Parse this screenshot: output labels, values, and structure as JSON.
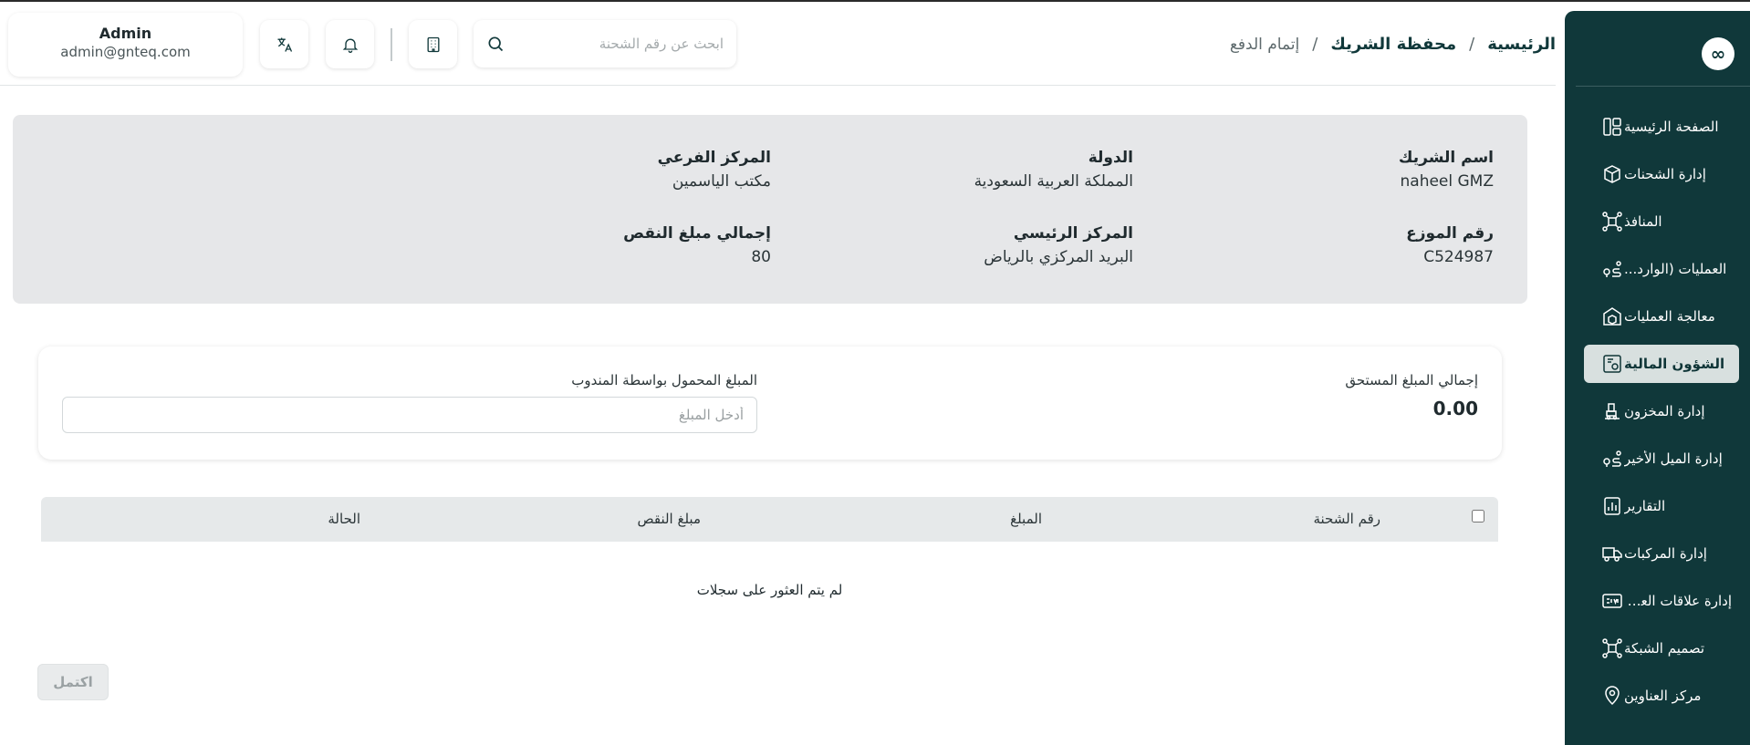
{
  "header": {
    "breadcrumb": {
      "home": "الرئيسية",
      "separator": "/",
      "wallet": "محفظة الشريك",
      "current": "إتمام الدفع"
    },
    "search_placeholder": "ابحث عن رقم الشحنة",
    "user": {
      "name": "Admin",
      "email": "admin@gnteq.com"
    }
  },
  "sidebar": {
    "logo_glyph": "∞",
    "items": [
      {
        "label": "الصفحة الرئيسية",
        "icon": "dashboard-icon"
      },
      {
        "label": "إدارة الشحنات",
        "icon": "package-icon"
      },
      {
        "label": "المنافذ",
        "icon": "network-icon"
      },
      {
        "label": "العمليات (الوارد...",
        "icon": "route-icon"
      },
      {
        "label": "معالجة العمليات",
        "icon": "warehouse-box-icon"
      },
      {
        "label": "الشؤون المالية",
        "icon": "finance-icon",
        "active": true
      },
      {
        "label": "إدارة المخزون",
        "icon": "forklift-icon"
      },
      {
        "label": "إدارة الميل الأخير",
        "icon": "route-icon"
      },
      {
        "label": "التقارير",
        "icon": "report-icon"
      },
      {
        "label": "إدارة المركبات",
        "icon": "truck-icon"
      },
      {
        "label": "إدارة علاقات العملاء",
        "icon": "crm-icon"
      },
      {
        "label": "تصميم الشبكة",
        "icon": "network-icon"
      },
      {
        "label": "مركز العناوين",
        "icon": "location-icon"
      }
    ]
  },
  "info": {
    "partner_name": {
      "label": "اسم الشريك",
      "value": "naheel GMZ"
    },
    "country": {
      "label": "الدولة",
      "value": "المملكة العربية السعودية"
    },
    "branch": {
      "label": "المركز الفرعي",
      "value": "مكتب الياسمين"
    },
    "distributor_no": {
      "label": "رقم الموزع",
      "value": "C524987"
    },
    "main_center": {
      "label": "المركز الرئيسي",
      "value": "البريد المركزي بالرياض"
    },
    "total_shortage": {
      "label": "إجمالي مبلغ النقص",
      "value": "80"
    }
  },
  "amounts": {
    "due_label": "إجمالي المبلغ المستحق",
    "due_value": "0.00",
    "carried_label": "المبلغ المحمول بواسطة المندوب",
    "carried_placeholder": "أدخل المبلغ"
  },
  "table": {
    "columns": [
      "رقم الشحنة",
      "المبلغ",
      "مبلغ النقص",
      "الحالة"
    ],
    "empty_message": "لم يتم العثور على سجلات"
  },
  "actions": {
    "complete_label": "اكتمل"
  },
  "colors": {
    "sidebar_bg": "#10383a",
    "active_item_bg": "#d8e0df",
    "info_panel_bg": "#e6e7e9"
  }
}
